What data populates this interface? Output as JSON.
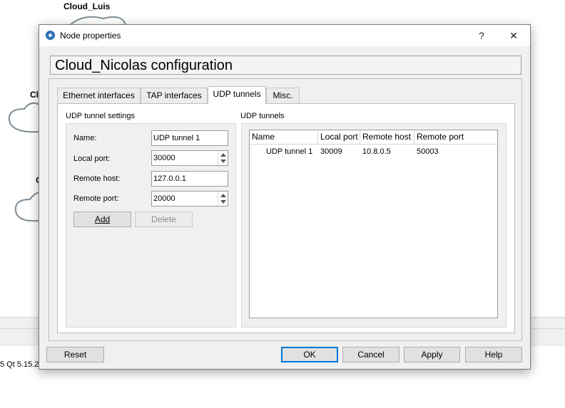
{
  "background": {
    "node_top_label": "Cloud_Luis",
    "node_mid_label": "Cl",
    "node_low_label": "C",
    "version_text": "5 Qt 5.15.2"
  },
  "dialog": {
    "title": "Node properties",
    "help_button": "?",
    "close_button": "✕",
    "config_title": "Cloud_Nicolas configuration",
    "tabs": [
      {
        "label": "Ethernet interfaces"
      },
      {
        "label": "TAP interfaces"
      },
      {
        "label": "UDP tunnels"
      },
      {
        "label": "Misc."
      }
    ],
    "active_tab": "UDP tunnels",
    "settings": {
      "group_title": "UDP tunnel settings",
      "name_label": "Name:",
      "name_value": "UDP tunnel 1",
      "local_port_label": "Local port:",
      "local_port_value": "30000",
      "remote_host_label": "Remote host:",
      "remote_host_value": "127.0.0.1",
      "remote_port_label": "Remote port:",
      "remote_port_value": "20000",
      "add_button": "Add",
      "delete_button": "Delete"
    },
    "tunnels": {
      "group_title": "UDP tunnels",
      "columns": [
        "Name",
        "Local port",
        "Remote host",
        "Remote port"
      ],
      "rows": [
        {
          "name": "UDP tunnel 1",
          "local_port": "30009",
          "remote_host": "10.8.0.5",
          "remote_port": "50003"
        }
      ]
    },
    "footer": {
      "reset": "Reset",
      "ok": "OK",
      "cancel": "Cancel",
      "apply": "Apply",
      "help": "Help"
    }
  },
  "colors": {
    "dialog_bg": "#f0f0f0",
    "accent": "#0078d7"
  }
}
